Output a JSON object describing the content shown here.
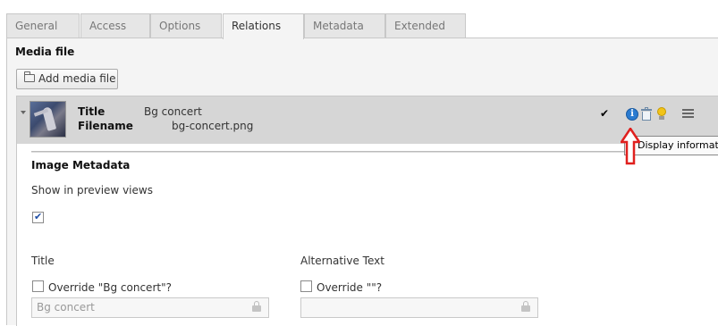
{
  "tabs": [
    {
      "label": "General",
      "active": false
    },
    {
      "label": "Access",
      "active": false
    },
    {
      "label": "Options",
      "active": false
    },
    {
      "label": "Relations",
      "active": true
    },
    {
      "label": "Metadata",
      "active": false
    },
    {
      "label": "Extended",
      "active": false
    }
  ],
  "media": {
    "section_title": "Media file",
    "add_button_label": "Add media file",
    "record": {
      "title_label": "Title",
      "title_value": "Bg concert",
      "filename_label": "Filename",
      "filename_value": "bg-concert.png",
      "status_mark": "✔",
      "tooltip": "Display information",
      "info_icon_glyph": "i"
    },
    "metadata": {
      "section_title": "Image Metadata",
      "show_in_preview_label": "Show in preview views",
      "show_in_preview_checked": true,
      "title_field": {
        "label": "Title",
        "override_label": "Override \"Bg concert\"?",
        "override_checked": false,
        "input_value": "Bg concert"
      },
      "alt_field": {
        "label": "Alternative Text",
        "override_label": "Override \"\"?",
        "override_checked": false,
        "input_value": ""
      }
    }
  },
  "colors": {
    "highlight_arrow": "#e0201e",
    "record_header_bg": "#d6d6d6",
    "panel_bg": "#f4f4f4",
    "info_icon": "#2a7bd0"
  }
}
